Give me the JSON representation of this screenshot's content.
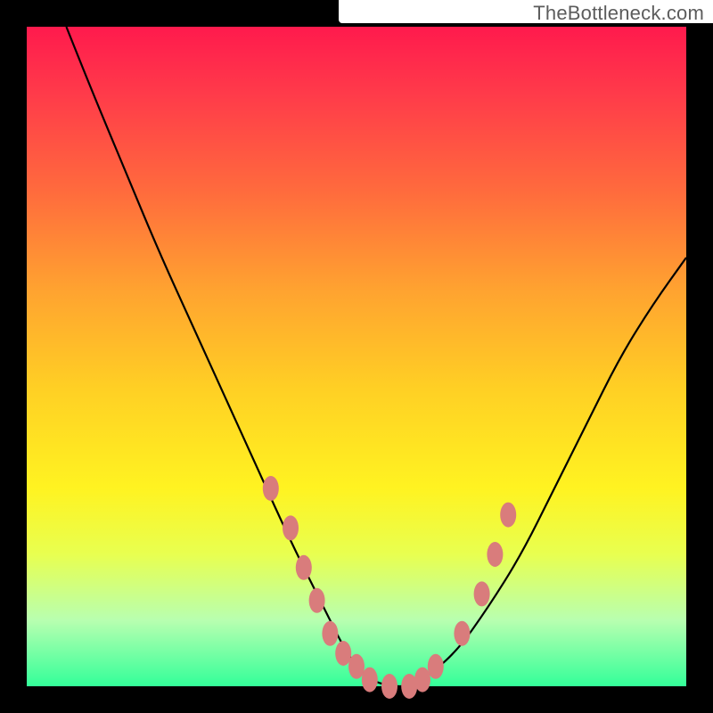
{
  "watermark": "TheBottleneck.com",
  "colors": {
    "gradient_top": "#ff1a4d",
    "gradient_mid": "#ffd024",
    "gradient_bottom": "#33ff99",
    "curve": "#000000",
    "markers": "#d97c7c",
    "frame": "#000000"
  },
  "chart_data": {
    "type": "line",
    "title": "",
    "xlabel": "",
    "ylabel": "",
    "xlim": [
      0,
      100
    ],
    "ylim": [
      0,
      100
    ],
    "note": "Values estimated from pixel positions; y = 100 corresponds to the top of the colored plot area.",
    "series": [
      {
        "name": "curve",
        "x": [
          6,
          10,
          15,
          20,
          25,
          30,
          35,
          40,
          45,
          48,
          50,
          52,
          55,
          58,
          60,
          65,
          70,
          75,
          80,
          85,
          90,
          95,
          100
        ],
        "y": [
          100,
          90,
          78,
          66,
          55,
          44,
          33,
          22,
          12,
          6,
          3,
          1,
          0,
          0,
          1,
          5,
          12,
          20,
          30,
          40,
          50,
          58,
          65
        ]
      }
    ],
    "markers": [
      {
        "x": 37,
        "y": 30
      },
      {
        "x": 40,
        "y": 24
      },
      {
        "x": 42,
        "y": 18
      },
      {
        "x": 44,
        "y": 13
      },
      {
        "x": 46,
        "y": 8
      },
      {
        "x": 48,
        "y": 5
      },
      {
        "x": 50,
        "y": 3
      },
      {
        "x": 52,
        "y": 1
      },
      {
        "x": 55,
        "y": 0
      },
      {
        "x": 58,
        "y": 0
      },
      {
        "x": 60,
        "y": 1
      },
      {
        "x": 62,
        "y": 3
      },
      {
        "x": 66,
        "y": 8
      },
      {
        "x": 69,
        "y": 14
      },
      {
        "x": 71,
        "y": 20
      },
      {
        "x": 73,
        "y": 26
      }
    ]
  }
}
